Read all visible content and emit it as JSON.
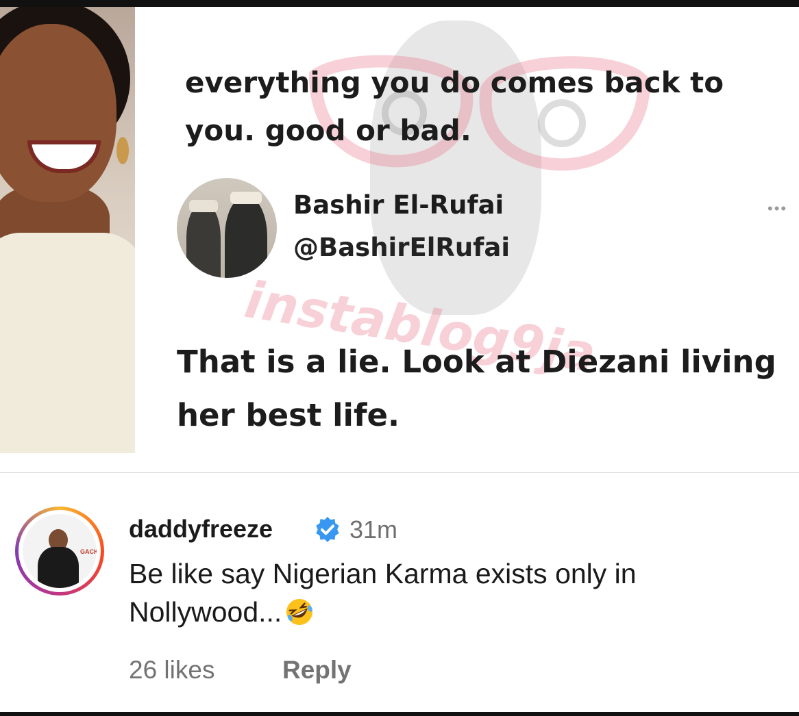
{
  "tweet": {
    "quoted_text": "everything you do comes back to you. good or bad.",
    "author_name": "Bashir El-Rufai",
    "author_handle": "@BashirElRufai",
    "reply_text": "That is a lie. Look at Diezani living her best life.",
    "more_icon": "more-horizontal-icon",
    "more_symbol": "•••"
  },
  "watermark": {
    "text": "instablog9ja",
    "color": "#eb788c"
  },
  "comment": {
    "username": "daddyfreeze",
    "verified_icon": "verified-badge-icon",
    "verified_color": "#3897f0",
    "time": "31m",
    "text": "Be like say Nigerian Karma exists only in Nollywood...",
    "emoji": "rolling-on-floor-laughing-icon",
    "likes": "26 likes",
    "reply_label": "Reply"
  }
}
